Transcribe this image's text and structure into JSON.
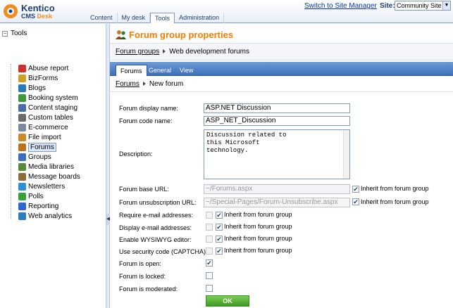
{
  "header": {
    "logo_line1": "Kentico",
    "logo_line2_a": "CMS ",
    "logo_line2_b": "Desk",
    "tabs": [
      "Content",
      "My desk",
      "Tools",
      "Administration"
    ],
    "active_tab": "Tools",
    "switch_link": "Switch to Site Manager",
    "site_label": "Site:",
    "site_value": "Community Site"
  },
  "tree": {
    "root": "Tools",
    "items": [
      {
        "label": "Abuse report",
        "icon": "abuse-report-icon",
        "color": "#d0312d"
      },
      {
        "label": "BizForms",
        "icon": "bizforms-icon",
        "color": "#c9a227"
      },
      {
        "label": "Blogs",
        "icon": "blogs-icon",
        "color": "#2a7ab8"
      },
      {
        "label": "Booking system",
        "icon": "booking-icon",
        "color": "#3c9a3c"
      },
      {
        "label": "Content staging",
        "icon": "staging-icon",
        "color": "#4a6fa5"
      },
      {
        "label": "Custom tables",
        "icon": "custom-tables-icon",
        "color": "#6b6b6b"
      },
      {
        "label": "E-commerce",
        "icon": "ecommerce-icon",
        "color": "#7d8a9c"
      },
      {
        "label": "File import",
        "icon": "file-import-icon",
        "color": "#c98a2a"
      },
      {
        "label": "Forums",
        "icon": "forums-icon",
        "color": "#b8741e"
      },
      {
        "label": "Groups",
        "icon": "groups-icon",
        "color": "#3d6fb9"
      },
      {
        "label": "Media libraries",
        "icon": "media-icon",
        "color": "#5a8a3c"
      },
      {
        "label": "Message boards",
        "icon": "message-boards-icon",
        "color": "#8a6d3b"
      },
      {
        "label": "Newsletters",
        "icon": "newsletters-icon",
        "color": "#2f8fd0"
      },
      {
        "label": "Polls",
        "icon": "polls-icon",
        "color": "#3aa03a"
      },
      {
        "label": "Reporting",
        "icon": "reporting-icon",
        "color": "#3366cc"
      },
      {
        "label": "Web analytics",
        "icon": "web-analytics-icon",
        "color": "#2c7fb8"
      }
    ],
    "selected": "Forums"
  },
  "main": {
    "title": "Forum group properties",
    "breadcrumb_link": "Forum groups",
    "breadcrumb_current": "Web development forums",
    "tabs": [
      "Forums",
      "General",
      "View"
    ],
    "active_tab": "Forums",
    "sub_breadcrumb_link": "Forums",
    "sub_breadcrumb_current": "New forum"
  },
  "form": {
    "display_name_label": "Forum display name:",
    "display_name_value": "ASP.NET Discussion",
    "code_name_label": "Forum code name:",
    "code_name_value": "ASP_NET_Discussion",
    "description_label": "Description:",
    "description_value": "Discussion related to this Microsoft technology.",
    "base_url_label": "Forum base URL:",
    "base_url_value": "~/Forums.aspx",
    "unsub_url_label": "Forum unsubscription URL:",
    "unsub_url_value": "~/Special-Pages/Forum-Unsubscribe.aspx",
    "inherit_label": "Inherit from forum group",
    "require_email_label": "Require e-mail addresses:",
    "display_email_label": "Display e-mail addresses:",
    "wysiwyg_label": "Enable WYSIWYG editor:",
    "captcha_label": "Use security code (CAPTCHA):",
    "is_open_label": "Forum is open:",
    "is_locked_label": "Forum is locked:",
    "is_moderated_label": "Forum is moderated:",
    "ok_label": "OK"
  }
}
